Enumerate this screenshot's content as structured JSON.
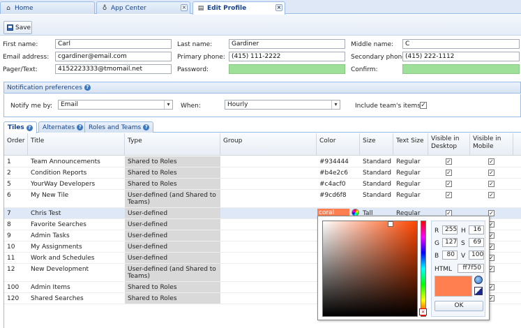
{
  "tabs": [
    {
      "label": "Home"
    },
    {
      "label": "App Center"
    },
    {
      "label": "Edit Profile"
    }
  ],
  "toolbar": {
    "save_label": "Save"
  },
  "form": {
    "first_name_label": "First name:",
    "first_name": "Carl",
    "last_name_label": "Last name:",
    "last_name": "Gardiner",
    "middle_name_label": "Middle name:",
    "middle_name": "C",
    "email_label": "Email address:",
    "email": "cgardiner@email.com",
    "primary_phone_label": "Primary phone:",
    "primary_phone": "(415) 111-2222",
    "secondary_phone_label": "Secondary phone:",
    "secondary_phone": "(415) 222-1112",
    "pager_label": "Pager/Text:",
    "pager": "4152223333@tmomail.net",
    "password_label": "Password:",
    "password": "",
    "confirm_label": "Confirm:",
    "confirm": ""
  },
  "notifications": {
    "title": "Notification preferences",
    "notify_label": "Notify me by:",
    "notify_value": "Email",
    "when_label": "When:",
    "when_value": "Hourly",
    "include_label": "Include team's items:",
    "include_checked": true
  },
  "subtabs": [
    {
      "label": "Tiles"
    },
    {
      "label": "Alternates"
    },
    {
      "label": "Roles and Teams"
    }
  ],
  "grid": {
    "columns": [
      "Order",
      "Title",
      "Type",
      "Group",
      "Color",
      "Size",
      "Text Size",
      "Visible in Desktop",
      "Visible in Mobile"
    ],
    "rows": [
      {
        "order": "1",
        "title": "Team Announcements",
        "type": "Shared to Roles",
        "group": "",
        "color": "#934444",
        "size": "Standard",
        "text_size": "Regular",
        "desktop": true,
        "mobile": true
      },
      {
        "order": "2",
        "title": "Condition Reports",
        "type": "Shared to Roles",
        "group": "",
        "color": "#b4e2c6",
        "size": "Standard",
        "text_size": "Regular",
        "desktop": true,
        "mobile": true
      },
      {
        "order": "5",
        "title": "YourWay Developers",
        "type": "Shared to Roles",
        "group": "",
        "color": "#c4acf0",
        "size": "Standard",
        "text_size": "Regular",
        "desktop": true,
        "mobile": true
      },
      {
        "order": "6",
        "title": "My New Tile",
        "type": "User-defined (and Shared to Teams)",
        "group": "",
        "color": "#9cd6f8",
        "size": "Standard",
        "text_size": "Regular",
        "desktop": true,
        "mobile": true
      },
      {
        "order": "7",
        "title": "Chris Test",
        "type": "User-defined",
        "group": "",
        "color": "coral",
        "size": "Tall",
        "text_size": "Regular",
        "desktop": true,
        "mobile": true
      },
      {
        "order": "8",
        "title": "Favorite Searches",
        "type": "User-defined",
        "group": "",
        "color": "",
        "size": "",
        "text_size": "",
        "desktop": null,
        "mobile": true
      },
      {
        "order": "9",
        "title": "Admin Tasks",
        "type": "User-defined",
        "group": "",
        "color": "",
        "size": "",
        "text_size": "",
        "desktop": null,
        "mobile": true
      },
      {
        "order": "10",
        "title": "My Assignments",
        "type": "User-defined",
        "group": "",
        "color": "",
        "size": "",
        "text_size": "",
        "desktop": null,
        "mobile": true
      },
      {
        "order": "11",
        "title": "Work and Schedules",
        "type": "User-defined",
        "group": "",
        "color": "",
        "size": "",
        "text_size": "",
        "desktop": null,
        "mobile": true
      },
      {
        "order": "12",
        "title": "New Development",
        "type": "User-defined (and Shared to Teams)",
        "group": "",
        "color": "",
        "size": "",
        "text_size": "",
        "desktop": null,
        "mobile": true
      },
      {
        "order": "100",
        "title": "Admin Items",
        "type": "Shared to Roles",
        "group": "",
        "color": "",
        "size": "",
        "text_size": "",
        "desktop": null,
        "mobile": true
      },
      {
        "order": "120",
        "title": "Shared Searches",
        "type": "Shared to Roles",
        "group": "",
        "color": "",
        "size": "",
        "text_size": "",
        "desktop": null,
        "mobile": true
      }
    ]
  },
  "color_picker": {
    "r_label": "R",
    "r": "255",
    "g_label": "G",
    "g": "127",
    "b_label": "B",
    "b": "80",
    "h_label": "H",
    "h": "16",
    "s_label": "S",
    "s": "69",
    "v_label": "V",
    "v": "100",
    "html_label": "HTML",
    "html": "ff7f50",
    "ok_label": "OK",
    "current_color": "#ff7f50"
  }
}
